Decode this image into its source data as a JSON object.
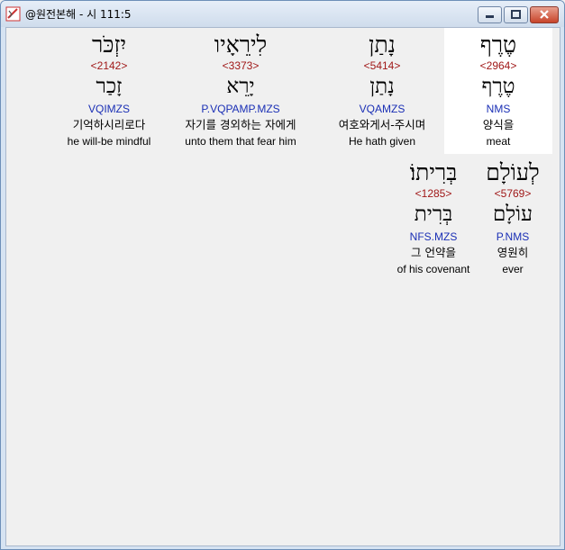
{
  "window": {
    "title": "@원전본해 - 시 111:5"
  },
  "words": [
    {
      "hebrew": "טֶרֶף",
      "strong": "<2964>",
      "lemma": "טֶרֶף",
      "morph": "NMS",
      "korean": "양식을",
      "english": "meat",
      "selected": true
    },
    {
      "hebrew": "נָתַן",
      "strong": "<5414>",
      "lemma": "נָתַן",
      "morph": "VQAMZS",
      "korean": "여호와게서-주시며",
      "english": "He hath given",
      "selected": false
    },
    {
      "hebrew": "לִירֵאָיו",
      "strong": "<3373>",
      "lemma": "יָרֵא",
      "morph": "P.VQPAMP.MZS",
      "korean": "자기를 경외하는 자에게",
      "english": "unto them that fear him",
      "selected": false
    },
    {
      "hebrew": "יִזְכֹּר",
      "strong": "<2142>",
      "lemma": "זָכַר",
      "morph": "VQIMZS",
      "korean": "기억하시리로다",
      "english": "he will-be mindful",
      "selected": false
    },
    {
      "hebrew": "לְעוֹלָם",
      "strong": "<5769>",
      "lemma": "עוֹלָם",
      "morph": "P.NMS",
      "korean": "영원히",
      "english": "ever",
      "selected": false
    },
    {
      "hebrew": "בְּרִיתוֹ׃",
      "strong": "<1285>",
      "lemma": "בְּרִית",
      "morph": "NFS.MZS",
      "korean": "그 언약을",
      "english": "of his covenant",
      "selected": false
    }
  ]
}
